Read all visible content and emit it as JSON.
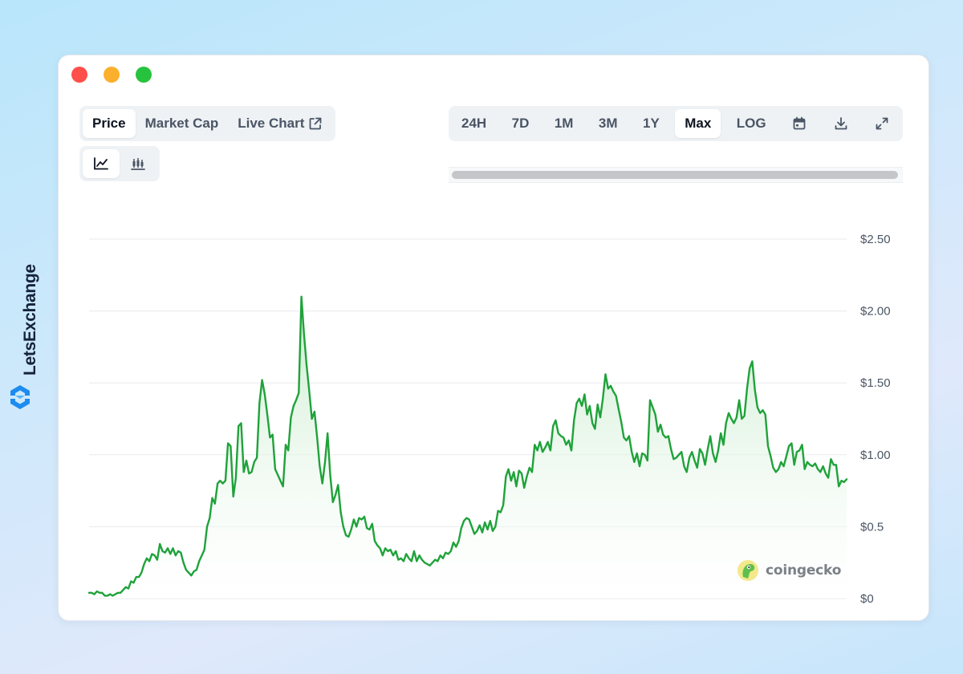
{
  "brand": {
    "name": "LetsExchange"
  },
  "tabs": {
    "price": "Price",
    "market_cap": "Market Cap",
    "live_chart": "Live Chart"
  },
  "ranges": {
    "h24": "24H",
    "d7": "7D",
    "m1": "1M",
    "m3": "3M",
    "y1": "1Y",
    "max": "Max",
    "log": "LOG"
  },
  "watermark": {
    "text": "coingecko"
  },
  "colors": {
    "line": "#1fa23a",
    "fill_top": "#c7ebcc",
    "accent_brand": "#1c8cf0"
  },
  "chart_data": {
    "type": "area",
    "title": "",
    "xlabel": "",
    "ylabel": "",
    "ylim": [
      0,
      2.5
    ],
    "y_ticks": [
      {
        "value": 0,
        "label": "$0"
      },
      {
        "value": 0.5,
        "label": "$0.5"
      },
      {
        "value": 1.0,
        "label": "$1.00"
      },
      {
        "value": 1.5,
        "label": "$1.50"
      },
      {
        "value": 2.0,
        "label": "$2.00"
      },
      {
        "value": 2.5,
        "label": "$2.50"
      }
    ],
    "grid": true,
    "values": [
      0.04,
      0.04,
      0.03,
      0.05,
      0.04,
      0.04,
      0.02,
      0.02,
      0.03,
      0.02,
      0.03,
      0.04,
      0.04,
      0.06,
      0.08,
      0.07,
      0.12,
      0.11,
      0.15,
      0.15,
      0.18,
      0.24,
      0.28,
      0.26,
      0.31,
      0.3,
      0.27,
      0.38,
      0.33,
      0.32,
      0.35,
      0.31,
      0.35,
      0.3,
      0.33,
      0.32,
      0.25,
      0.2,
      0.18,
      0.16,
      0.19,
      0.2,
      0.26,
      0.3,
      0.34,
      0.5,
      0.56,
      0.7,
      0.66,
      0.8,
      0.82,
      0.8,
      0.82,
      1.08,
      1.06,
      0.71,
      0.84,
      1.2,
      1.22,
      0.88,
      0.96,
      0.87,
      0.88,
      0.95,
      0.98,
      1.36,
      1.52,
      1.42,
      1.28,
      1.12,
      1.14,
      0.9,
      0.86,
      0.82,
      0.78,
      1.07,
      1.03,
      1.26,
      1.34,
      1.38,
      1.43,
      2.1,
      1.84,
      1.62,
      1.44,
      1.25,
      1.3,
      1.12,
      0.92,
      0.8,
      0.95,
      1.15,
      0.86,
      0.67,
      0.72,
      0.79,
      0.6,
      0.5,
      0.44,
      0.43,
      0.48,
      0.55,
      0.5,
      0.56,
      0.55,
      0.57,
      0.49,
      0.48,
      0.52,
      0.4,
      0.37,
      0.35,
      0.3,
      0.35,
      0.33,
      0.34,
      0.3,
      0.33,
      0.27,
      0.28,
      0.26,
      0.31,
      0.28,
      0.26,
      0.33,
      0.26,
      0.3,
      0.27,
      0.25,
      0.24,
      0.23,
      0.25,
      0.27,
      0.26,
      0.3,
      0.28,
      0.32,
      0.31,
      0.33,
      0.39,
      0.36,
      0.4,
      0.49,
      0.54,
      0.56,
      0.55,
      0.5,
      0.45,
      0.47,
      0.51,
      0.46,
      0.53,
      0.48,
      0.54,
      0.47,
      0.5,
      0.61,
      0.6,
      0.65,
      0.85,
      0.9,
      0.82,
      0.88,
      0.78,
      0.89,
      0.87,
      0.77,
      0.85,
      0.91,
      0.88,
      1.07,
      1.03,
      1.09,
      1.02,
      1.05,
      1.09,
      1.03,
      1.2,
      1.24,
      1.15,
      1.13,
      1.12,
      1.07,
      1.1,
      1.03,
      1.24,
      1.36,
      1.39,
      1.34,
      1.42,
      1.28,
      1.34,
      1.22,
      1.18,
      1.35,
      1.26,
      1.39,
      1.56,
      1.46,
      1.48,
      1.44,
      1.41,
      1.32,
      1.23,
      1.12,
      1.1,
      1.13,
      1.02,
      0.95,
      1.01,
      0.92,
      1.01,
      1.0,
      0.96,
      1.38,
      1.33,
      1.28,
      1.16,
      1.21,
      1.14,
      1.12,
      1.13,
      1.04,
      0.97,
      0.98,
      1.0,
      1.02,
      0.92,
      0.88,
      0.98,
      1.02,
      0.96,
      0.91,
      1.04,
      1.01,
      0.93,
      1.04,
      1.13,
      1.01,
      0.95,
      1.03,
      1.15,
      1.07,
      1.22,
      1.29,
      1.25,
      1.22,
      1.26,
      1.38,
      1.25,
      1.27,
      1.46,
      1.6,
      1.65,
      1.45,
      1.33,
      1.29,
      1.31,
      1.28,
      1.06,
      0.99,
      0.91,
      0.88,
      0.9,
      0.95,
      0.92,
      0.99,
      1.06,
      1.08,
      0.93,
      1.02,
      1.03,
      1.07,
      0.9,
      0.95,
      0.93,
      0.92,
      0.94,
      0.9,
      0.88,
      0.92,
      0.87,
      0.84,
      0.97,
      0.93,
      0.93,
      0.78,
      0.82,
      0.81,
      0.83
    ]
  }
}
